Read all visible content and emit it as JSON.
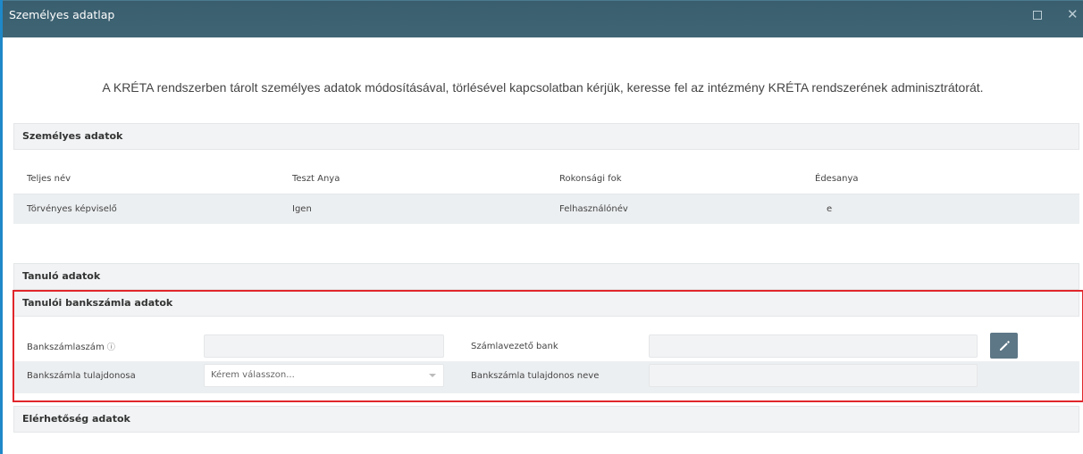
{
  "window": {
    "title": "Személyes adatlap",
    "max_icon": "maximize-icon",
    "close_icon": "close-icon",
    "close_glyph": "✕"
  },
  "notice": "A KRÉTA rendszerben tárolt személyes adatok módosításával, törlésével kapcsolatban kérjük, keresse fel az intézmény KRÉTA rendszerének adminisztrátorát.",
  "personal": {
    "header": "Személyes adatok",
    "rows": [
      {
        "label1": "Teljes név",
        "value1": "Teszt Anya",
        "label2": "Rokonsági fok",
        "value2": "Édesanya"
      },
      {
        "label1": "Törvényes képviselő",
        "value1": "Igen",
        "label2": "Felhasználónév",
        "value2": "e"
      }
    ]
  },
  "student": {
    "header": "Tanuló adatok"
  },
  "bank": {
    "header": "Tanulói bankszámla adatok",
    "account_number_label": "Bankszámlaszám",
    "info_glyph": "ⓘ",
    "account_number_value": "",
    "bank_label": "Számlavezető bank",
    "bank_value": "",
    "owner_label": "Bankszámla tulajdonosa",
    "owner_placeholder": "Kérem válasszon...",
    "owner_name_label": "Bankszámla tulajdonos neve",
    "owner_name_value": "",
    "edit_icon": "pencil-icon"
  },
  "contact": {
    "header": "Elérhetőség adatok"
  },
  "colors": {
    "titlebar": "#3f6575",
    "accent_border": "#1e88c8",
    "highlight": "#e0262b",
    "edit_button": "#5d7786"
  }
}
